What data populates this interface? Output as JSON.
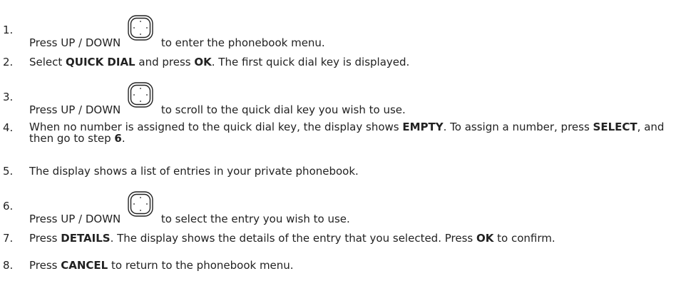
{
  "steps": [
    {
      "num": "1.",
      "pre": "Press UP / DOWN",
      "post": "to enter the phonebook menu.",
      "icon": "nav-key-icon"
    },
    {
      "num": "2.",
      "t1": "Select ",
      "b1": "QUICK DIAL",
      "t2": " and press ",
      "b2": "OK",
      "t3": ". The first quick dial key is displayed."
    },
    {
      "num": "3.",
      "pre": "Press UP / DOWN",
      "post": "to scroll to the quick dial key you wish to use.",
      "icon": "nav-key-icon"
    },
    {
      "num": "4.",
      "t1": "When no number is assigned to the quick dial key, the display shows ",
      "b1": "EMPTY",
      "t2": ". To assign a number, press ",
      "b2": "SELECT",
      "t3": ", and then go to step ",
      "b3": "6",
      "t4": "."
    },
    {
      "num": "5.",
      "t1": "The display shows a list of entries in your private phonebook."
    },
    {
      "num": "6.",
      "pre": "Press UP / DOWN",
      "post": "to select the entry you wish to use.",
      "icon": "nav-key-icon"
    },
    {
      "num": "7.",
      "t1": "Press ",
      "b1": "DETAILS",
      "t2": ". The display shows the details of the entry that you selected. Press ",
      "b2": "OK",
      "t3": " to confirm."
    },
    {
      "num": "8.",
      "t1": "Press ",
      "b1": "CANCEL",
      "t2": " to return to the phonebook menu."
    }
  ]
}
